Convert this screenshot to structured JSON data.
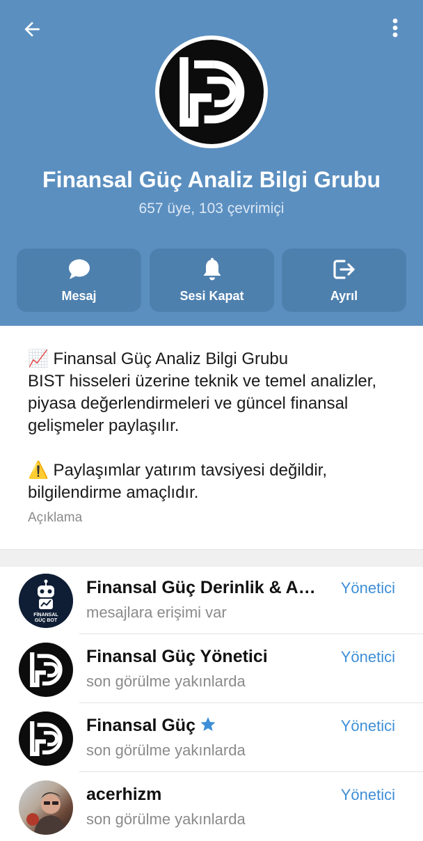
{
  "header": {
    "back_icon": "arrow-left-icon",
    "more_icon": "kebab-menu-icon",
    "title": "Finansal Güç Analiz Bilgi Grubu",
    "subtitle": "657 üye, 103 çevrimiçi",
    "background_color": "#5b8fc0"
  },
  "actions": [
    {
      "label": "Mesaj",
      "icon": "chat-bubble-icon"
    },
    {
      "label": "Sesi Kapat",
      "icon": "bell-icon"
    },
    {
      "label": "Ayrıl",
      "icon": "exit-icon"
    }
  ],
  "about": {
    "line1": "📈 Finansal Güç Analiz Bilgi Grubu\nBIST hisseleri üzerine teknik ve temel analizler, piyasa değerlendirmeleri ve güncel finansal gelişmeler paylaşılır.",
    "line2": "⚠️ Paylaşımlar yatırım tavsiyesi değildir, bilgilendirme amaçlıdır.",
    "label": "Açıklama"
  },
  "members": [
    {
      "name": "Finansal Güç Derinlik & AK…",
      "status": "mesajlara erişimi var",
      "role": "Yönetici",
      "avatar": "finansal-guc-bot-logo",
      "avatar_text_1": "FİNANSAL",
      "avatar_text_2": "GÜÇ BOT"
    },
    {
      "name": "Finansal Güç Yönetici",
      "status": "son görülme yakınlarda",
      "role": "Yönetici",
      "avatar": "fgd-logo"
    },
    {
      "name": "Finansal Güç",
      "status": "son görülme yakınlarda",
      "role": "Yönetici",
      "avatar": "fgd-logo",
      "badge": "star-icon"
    },
    {
      "name": "acerhizm",
      "status": "son görülme yakınlarda",
      "role": "Yönetici",
      "avatar": "user-photo"
    }
  ],
  "colors": {
    "accent": "#3d8ed6",
    "action_bg": "#4e80ae"
  }
}
